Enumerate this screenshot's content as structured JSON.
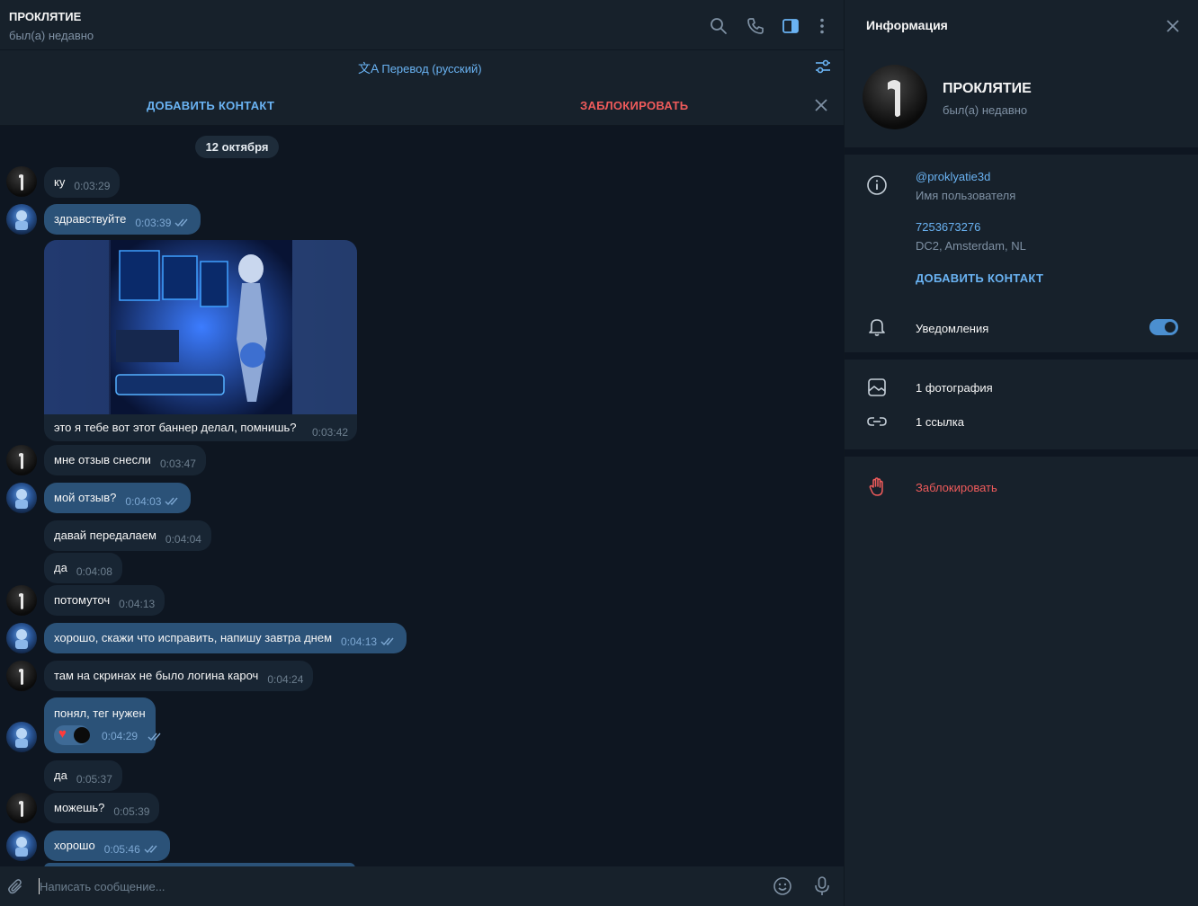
{
  "chat": {
    "title": "ПРОКЛЯТИЕ",
    "status": "был(а) недавно",
    "translate_label": "Перевод (русский)",
    "add_contact": "ДОБАВИТЬ КОНТАКТ",
    "block": "ЗАБЛОКИРОВАТЬ",
    "date_chip": "12 октября",
    "messages": [
      {
        "text": "ку",
        "time": "0:03:29"
      },
      {
        "text": "здравствуйте",
        "time": "0:03:39"
      },
      {
        "text": "это я тебе вот этот баннер делал, помнишь?",
        "time": "0:03:42"
      },
      {
        "text": "мне отзыв снесли",
        "time": "0:03:47"
      },
      {
        "text": "мой отзыв?",
        "time": "0:04:03"
      },
      {
        "text": "давай передалаем",
        "time": "0:04:04"
      },
      {
        "text": "да",
        "time": "0:04:08"
      },
      {
        "text": "потомуточ",
        "time": "0:04:13"
      },
      {
        "text": "хорошо, скажи что исправить, напишу завтра днем",
        "time": "0:04:13"
      },
      {
        "text": "там на скринах не было логина кароч",
        "time": "0:04:24"
      },
      {
        "text": "понял, тег нужен",
        "time": "0:04:29"
      },
      {
        "text": "да",
        "time": "0:05:37"
      },
      {
        "text": "можешь?",
        "time": "0:05:39"
      },
      {
        "text": "хорошо",
        "time": "0:05:46"
      }
    ],
    "composer_placeholder": "Написать сообщение..."
  },
  "info": {
    "title": "Информация",
    "name": "ПРОКЛЯТИЕ",
    "status": "был(а) недавно",
    "username": "@proklyatie3d",
    "username_label": "Имя пользователя",
    "id": "7253673276",
    "dc": "DC2, Amsterdam, NL",
    "add_contact": "ДОБАВИТЬ КОНТАКТ",
    "notifications": "Уведомления",
    "notifications_on": true,
    "photos": "1 фотография",
    "links": "1 ссылка",
    "block": "Заблокировать"
  },
  "colors": {
    "accent": "#6ab3f3",
    "danger": "#ef5b5b",
    "outgoing_bubble": "#2b5278",
    "incoming_bubble": "#182533"
  }
}
